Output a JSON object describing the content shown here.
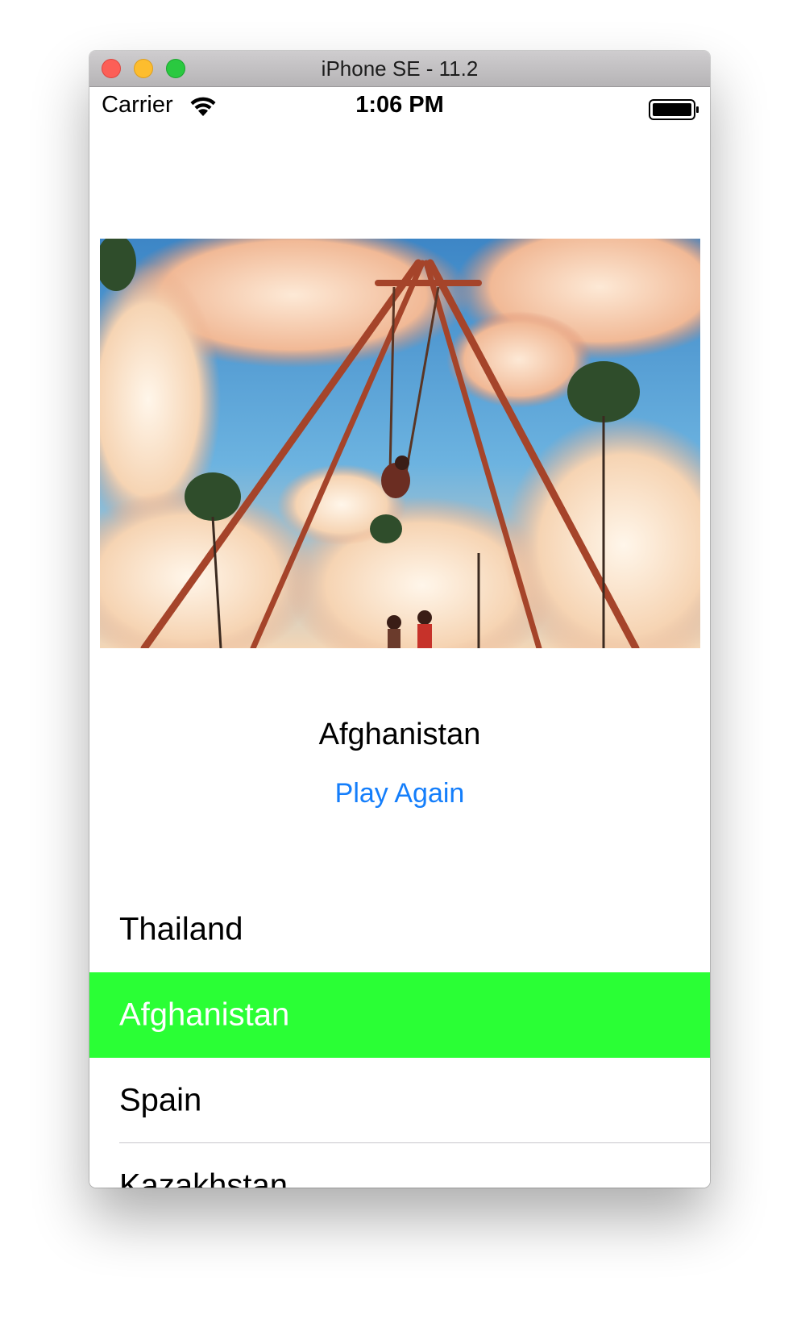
{
  "window": {
    "title": "iPhone SE - 11.2"
  },
  "status_bar": {
    "carrier": "Carrier",
    "time": "1:06 PM"
  },
  "quiz": {
    "answer": "Afghanistan",
    "play_again_label": "Play Again",
    "options": [
      {
        "label": "Thailand",
        "state": "normal"
      },
      {
        "label": "Afghanistan",
        "state": "correct"
      },
      {
        "label": "Spain",
        "state": "normal"
      },
      {
        "label": "Kazakhstan",
        "state": "normal"
      }
    ]
  },
  "colors": {
    "accent": "#147efb",
    "correct_highlight": "#2aff35"
  },
  "icons": {
    "close": "close-icon",
    "minimize": "minimize-icon",
    "zoom": "zoom-icon",
    "wifi": "wifi-icon",
    "battery": "battery-icon"
  }
}
